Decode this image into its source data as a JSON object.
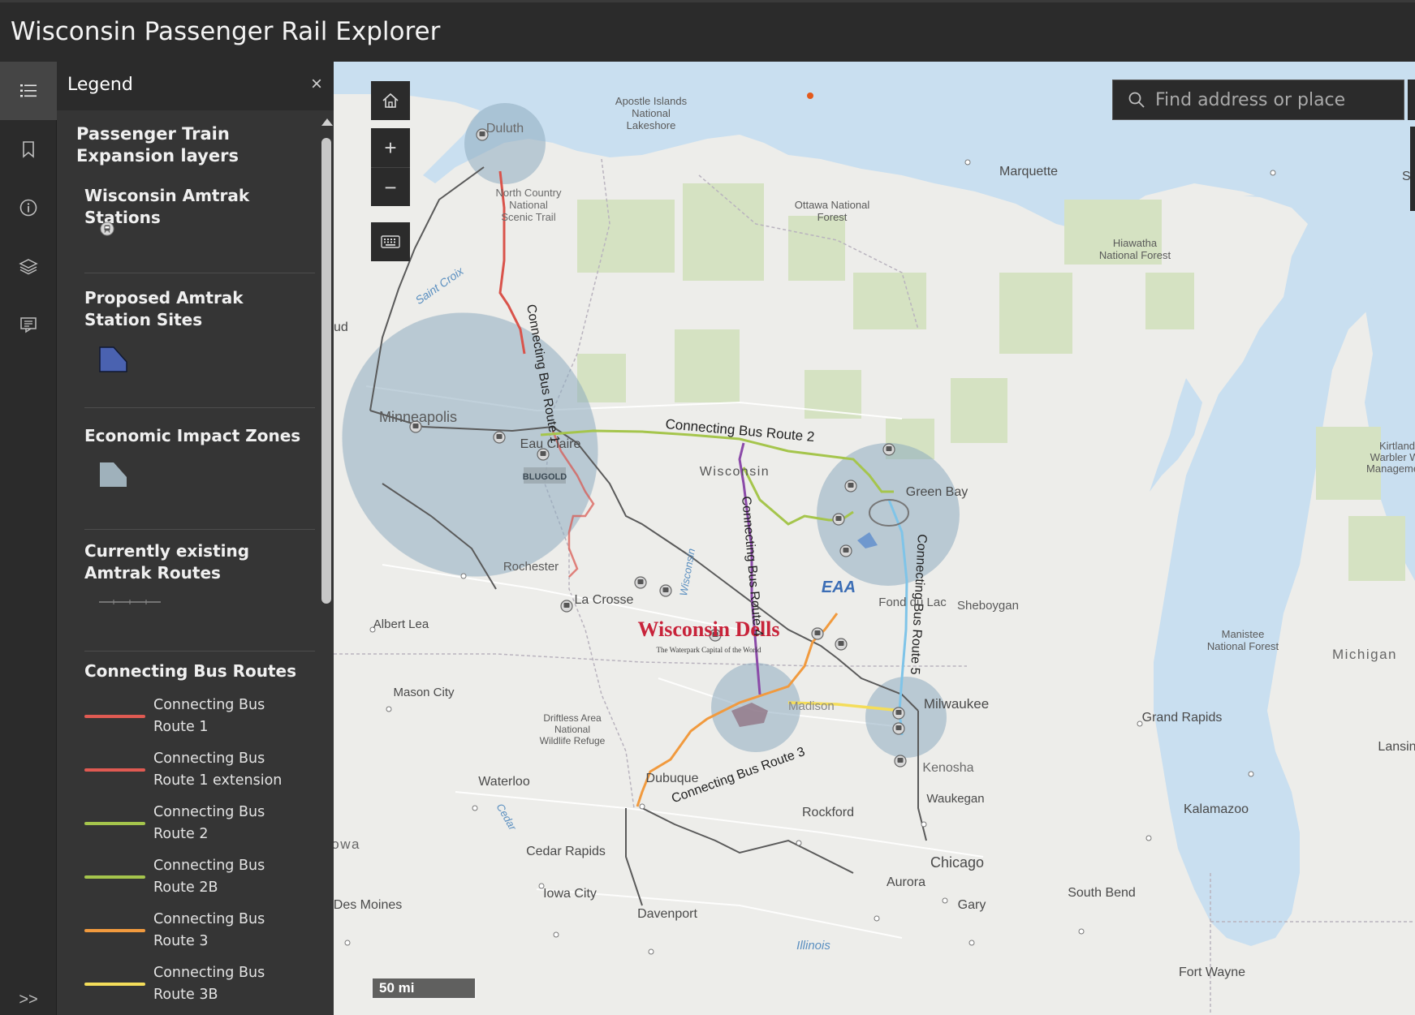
{
  "app": {
    "title": "Wisconsin Passenger Rail Explorer"
  },
  "action_bar": {
    "items": [
      {
        "name": "legend",
        "icon": "legend-list-icon"
      },
      {
        "name": "bookmarks",
        "icon": "bookmark-icon"
      },
      {
        "name": "about",
        "icon": "info-icon"
      },
      {
        "name": "layers",
        "icon": "layers-icon"
      },
      {
        "name": "basemaps",
        "icon": "basemap-icon"
      }
    ],
    "collapse_label": ">>"
  },
  "legend": {
    "title": "Legend",
    "close_label": "×",
    "group_title": "Passenger Train Expansion layers",
    "sections": [
      {
        "title": "Wisconsin Amtrak Stations"
      },
      {
        "title": "Proposed Amtrak Station Sites"
      },
      {
        "title": "Economic Impact Zones"
      },
      {
        "title": "Currently existing Amtrak Routes"
      },
      {
        "title": "Connecting Bus Routes"
      }
    ],
    "bus_routes": [
      {
        "label": "Connecting Bus Route 1",
        "color": "#e05a52"
      },
      {
        "label": "Connecting Bus Route 1 extension",
        "color": "#e05a52"
      },
      {
        "label": "Connecting Bus Route 2",
        "color": "#a5c54c"
      },
      {
        "label": "Connecting Bus Route 2B",
        "color": "#a5c54c"
      },
      {
        "label": "Connecting Bus Route 3",
        "color": "#f19a3e"
      },
      {
        "label": "Connecting Bus Route 3B",
        "color": "#f4dd5a"
      }
    ],
    "colors": {
      "proposed_site": "#4a62b0",
      "impact_zone": "#9fb1bb",
      "existing_route": "#777777"
    }
  },
  "map": {
    "search_placeholder": "Find address or place",
    "scale_label": "50 mi",
    "controls": {
      "home": "⌂",
      "zoom_in": "+",
      "zoom_out": "−"
    },
    "labels": {
      "apostle": [
        "Apostle Islands",
        "National",
        "Lakeshore"
      ],
      "duluth": "Duluth",
      "north_country": [
        "North Country",
        "National",
        "Scenic Trail"
      ],
      "marquette": "Marquette",
      "ottawa": [
        "Ottawa National",
        "Forest"
      ],
      "hiawatha": [
        "Hiawatha",
        "National Forest"
      ],
      "sa": "Sa",
      "saint_croix": "Saint Croix",
      "ud": "ud",
      "minneapolis": "Minneapolis",
      "eau_claire": "Eau Claire",
      "bus_route_1": "Connecting Bus Route 1",
      "bus_route_2": "Connecting Bus Route 2",
      "bus_route_3": "Connecting Bus Route 3",
      "bus_route_4": "Connecting Bus Route 4",
      "bus_route_5": "Connecting Bus Route 5",
      "wisconsin": "Wisconsin",
      "green_bay": "Green Bay",
      "kirtland": [
        "Kirtland",
        "Warbler Wil",
        "Management"
      ],
      "rochester": "Rochester",
      "la_crosse": "La Crosse",
      "wisconsin_river": "Wisconsin",
      "fond_du_lac": "Fond du Lac",
      "sheboygan": "Sheboygan",
      "manistee": [
        "Manistee",
        "National Forest"
      ],
      "michigan": "Michigan",
      "albert_lea": "Albert Lea",
      "mason_city": "Mason City",
      "driftless": [
        "Driftless Area",
        "National",
        "Wildlife Refuge"
      ],
      "madison": "Madison",
      "milwaukee": "Milwaukee",
      "grand_rapids": "Grand Rapids",
      "lansing": "Lansin",
      "kenosha": "Kenosha",
      "waterloo": "Waterloo",
      "dubuque": "Dubuque",
      "cedar": "Cedar",
      "waukegan": "Waukegan",
      "kalamazoo": "Kalamazoo",
      "rockford": "Rockford",
      "iowa": "Iowa",
      "cedar_rapids": "Cedar Rapids",
      "chicago": "Chicago",
      "aurora": "Aurora",
      "des_moines": "Des Moines",
      "iowa_city": "Iowa City",
      "gary": "Gary",
      "south_bend": "South Bend",
      "davenport": "Davenport",
      "illinois": "Illinois",
      "fort_wayne": "Fort Wayne",
      "wisconsin_dells": "Wisconsin Dells",
      "dells_tagline": "The Waterpark Capital of the World",
      "blugold": "BLUGOLD",
      "eaa": "EAA"
    },
    "colors": {
      "water": "#c9dff0",
      "land": "#ededea",
      "forest": "#d5e2c2",
      "zone": "#8fabbf",
      "rail": "#555555",
      "route1": "#d9534b",
      "route2": "#a5c54c",
      "route3": "#f19a3e",
      "route3b": "#f4dd5a",
      "route4": "#8b4aa8",
      "route5": "#7fc4e8"
    }
  }
}
